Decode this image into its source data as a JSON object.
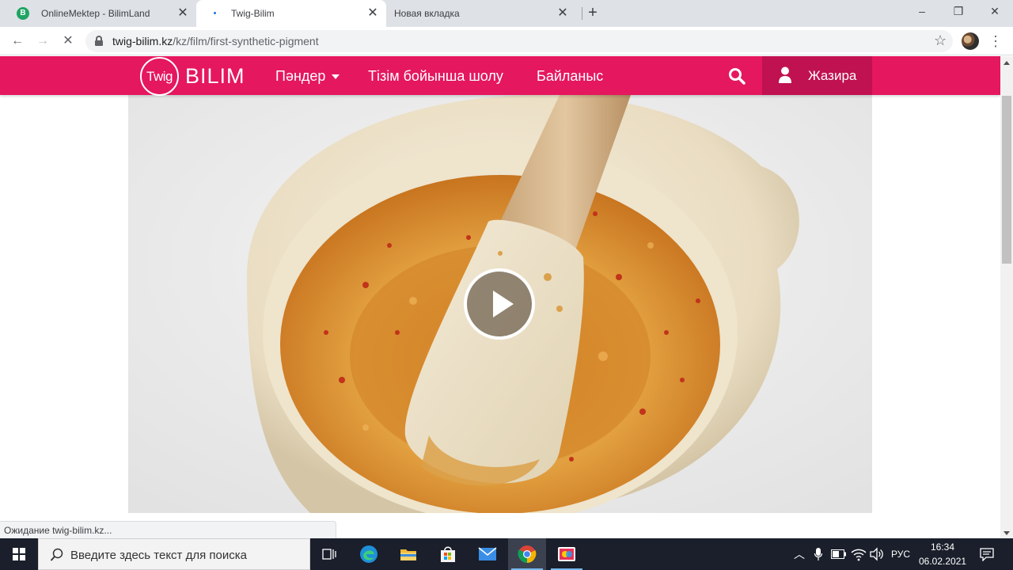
{
  "browser": {
    "tabs": [
      {
        "title": "OnlineMektep - BilimLand",
        "favicon": "bilimland-favicon",
        "active": false
      },
      {
        "title": "Twig-Bilim",
        "favicon": "loading-spinner-icon",
        "active": true
      },
      {
        "title": "Новая вкладка",
        "favicon": "",
        "active": false
      }
    ],
    "new_tab_icon": "plus-icon",
    "window_controls": {
      "minimize": "–",
      "restore": "❐",
      "close": "✕"
    },
    "address": {
      "host": "twig-bilim.kz",
      "path": "/kz/film/first-synthetic-pigment"
    },
    "nav_icons": {
      "back": "←",
      "forward": "→",
      "stop": "✕",
      "bookmark": "☆",
      "menu": "⋮"
    }
  },
  "site": {
    "brand_color": "#e5175e",
    "logo": {
      "ring_text": "Twig",
      "word": "BILIM"
    },
    "nav": {
      "subjects": "Пәндер",
      "browse_list": "Тізім бойынша шолу",
      "contact": "Байланыс"
    },
    "user": {
      "name": "Жазира"
    }
  },
  "film": {
    "play_icon": "play-icon"
  },
  "status_bar": {
    "text": "Ожидание twig-bilim.kz..."
  },
  "taskbar": {
    "search_placeholder": "Введите здесь текст для поиска",
    "pinned": [
      "task-view-icon",
      "edge-icon",
      "file-explorer-icon",
      "store-icon",
      "mail-icon",
      "chrome-icon",
      "photos-app-icon"
    ],
    "language": "РУС",
    "time": "16:34",
    "date": "06.02.2021"
  }
}
